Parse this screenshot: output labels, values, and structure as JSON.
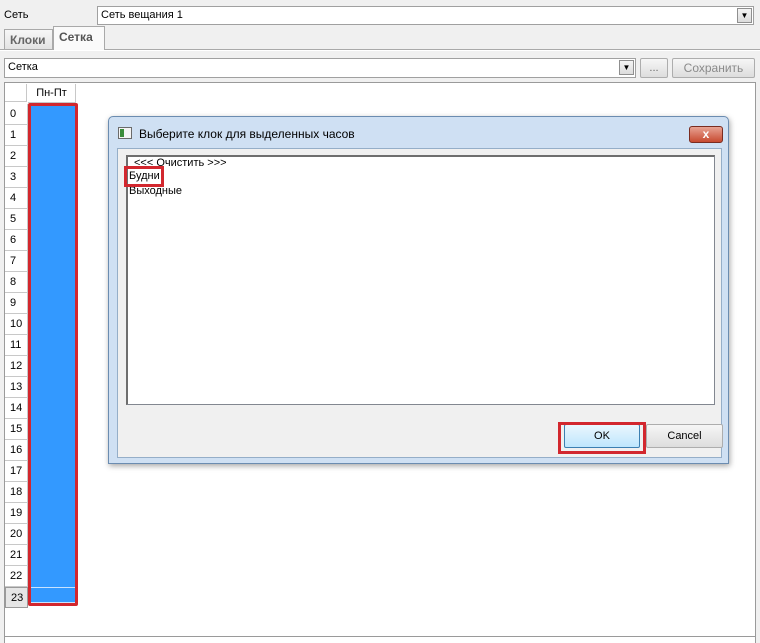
{
  "network": {
    "label": "Сеть",
    "selected": "Сеть вещания 1"
  },
  "tabs": [
    {
      "label": "Клоки",
      "active": false
    },
    {
      "label": "Сетка",
      "active": true
    }
  ],
  "grid_select": {
    "selected": "Сетка"
  },
  "toolbar": {
    "dots_label": "...",
    "save_label": "Сохранить"
  },
  "grid": {
    "column_header": "Пн-Пт",
    "rows": [
      "0",
      "1",
      "2",
      "3",
      "4",
      "5",
      "6",
      "7",
      "8",
      "9",
      "10",
      "11",
      "12",
      "13",
      "14",
      "15",
      "16",
      "17",
      "18",
      "19",
      "20",
      "21",
      "22",
      "23"
    ],
    "selected_color": "#3399ff"
  },
  "dialog": {
    "title": "Выберите клок для выделенных часов",
    "close_label": "x",
    "items": [
      "<<< Очистить >>>",
      "Будни",
      "Выходные"
    ],
    "ok_label": "OK",
    "cancel_label": "Cancel"
  },
  "colors": {
    "highlight": "#d2272e",
    "selection": "#3399ff"
  }
}
